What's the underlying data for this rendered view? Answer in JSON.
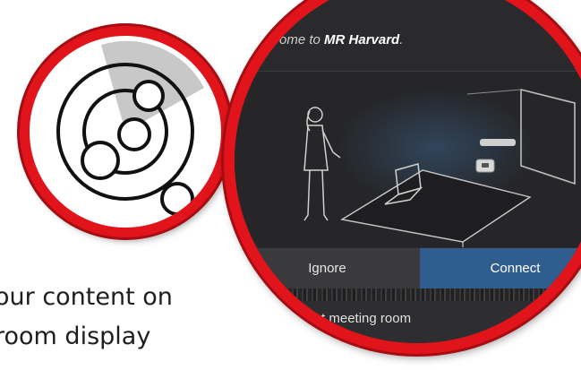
{
  "caption": {
    "line1": "our content on",
    "line2": "room display"
  },
  "dialog": {
    "welcome_prefix": "ome to ",
    "room_name": "MR Harvard",
    "welcome_suffix": ".",
    "ignore_label": "Ignore",
    "connect_label": "Connect",
    "select_room_label": "select meeting room"
  },
  "colors": {
    "accent_red": "#e1141b",
    "connect_blue": "#2f5e8e",
    "screen_dark": "#2c2c2e"
  },
  "icons": {
    "logo": "orbit-circles-icon"
  }
}
